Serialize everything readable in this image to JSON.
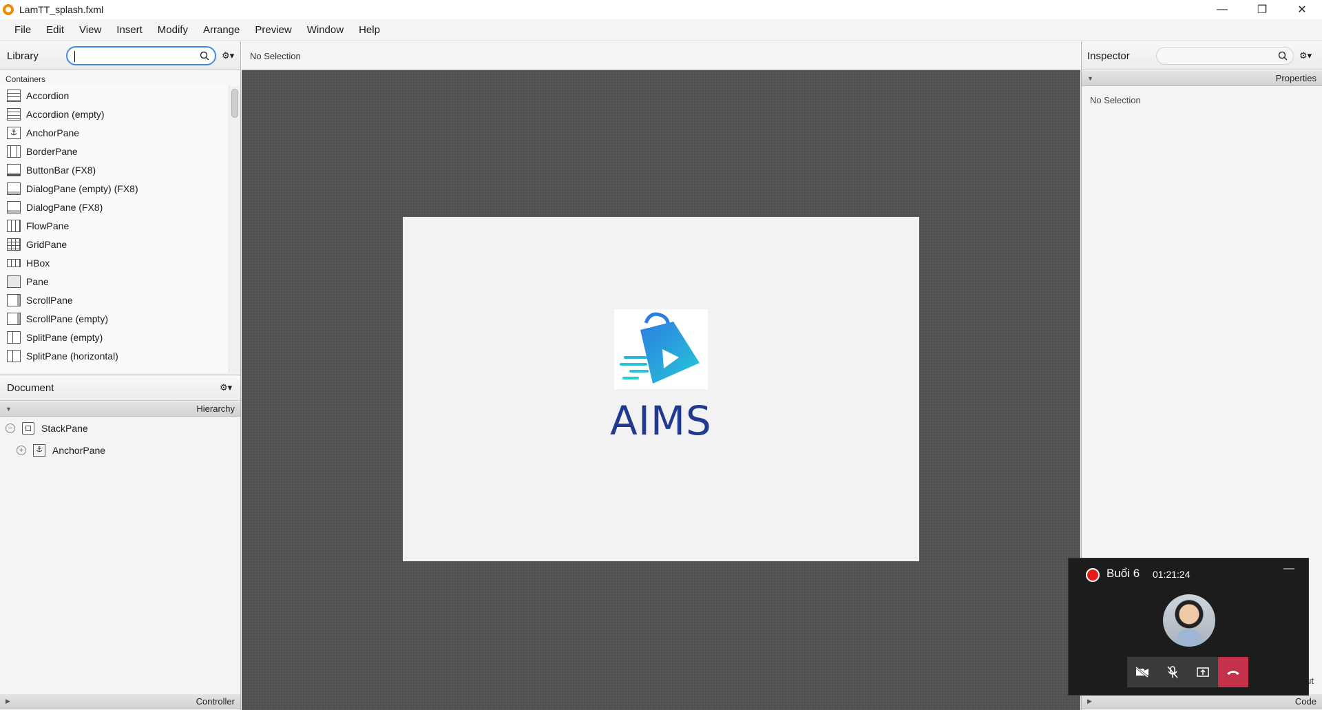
{
  "window": {
    "title": "LamTT_splash.fxml"
  },
  "menu": [
    "File",
    "Edit",
    "View",
    "Insert",
    "Modify",
    "Arrange",
    "Preview",
    "Window",
    "Help"
  ],
  "library": {
    "title": "Library",
    "search_value": "",
    "section": "Containers",
    "items": [
      "Accordion",
      "Accordion  (empty)",
      "AnchorPane",
      "BorderPane",
      "ButtonBar  (FX8)",
      "DialogPane (empty)  (FX8)",
      "DialogPane  (FX8)",
      "FlowPane",
      "GridPane",
      "HBox",
      "Pane",
      "ScrollPane",
      "ScrollPane  (empty)",
      "SplitPane  (empty)",
      "SplitPane  (horizontal)"
    ]
  },
  "document": {
    "title": "Document",
    "hierarchy_label": "Hierarchy",
    "tree": [
      {
        "label": "StackPane",
        "toggle": "−"
      },
      {
        "label": "AnchorPane",
        "toggle": "+"
      }
    ],
    "controller_label": "Controller"
  },
  "center": {
    "selection_text": "No Selection"
  },
  "splash": {
    "app_name": "AIMS"
  },
  "inspector": {
    "title": "Inspector",
    "properties_label": "Properties",
    "selection_text": "No Selection",
    "layout_label": "ut",
    "code_label": "Code"
  },
  "call": {
    "title": "Buổi 6",
    "time": "01:21:24",
    "minimize": "—",
    "record_color": "#e81b1b",
    "end_color": "#c4314b"
  },
  "colors": {
    "accent": "#3d8ee0",
    "brand_text": "#213a8f"
  }
}
